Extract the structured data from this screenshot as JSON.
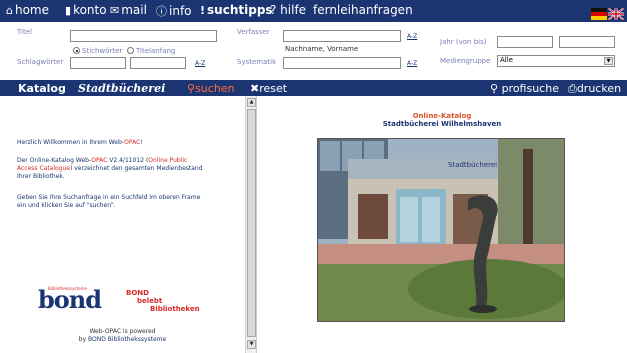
{
  "nav": {
    "home": "home",
    "konto": "konto",
    "mail": "mail",
    "info": "info",
    "suchtipps": "suchtipps",
    "hilfe": "? hilfe",
    "fernleih": "fernleihanfragen"
  },
  "form": {
    "titel_label": "Titel",
    "verfasser_label": "Verfasser",
    "jahr_label": "Jahr (von bis)",
    "schlag_label": "Schlagwörter",
    "systematik_label": "Systematik",
    "mediengruppe_label": "Mediengruppe",
    "radio_stich": "Stichwörter",
    "radio_titel": "Titelanfang",
    "name_hint": "Nachname, Vorname",
    "az": "A-Z",
    "mediengruppe_value": "Alle"
  },
  "actions": {
    "katalog": "Katalog",
    "stadt": "Stadtbücherei",
    "suchen": "suchen",
    "reset": "reset",
    "profisuche": "profisuche",
    "drucken": "drucken"
  },
  "left": {
    "welcome_pre": "Herzlich Willkommen in Ihrem Web-",
    "welcome_opac": "OPAC",
    "welcome_post": "!",
    "p1_a": "Der Online-Katalog Web-",
    "p1_opac": "OPAC",
    "p1_b": " V2.4/11012 (",
    "p1_olpac": "Online Public",
    "p1_line2_red": "Access Catalogue",
    "p1_line2_rest": ") verzeichnet den gesamten Medienbestand",
    "p1_line3": "Ihrer Bibliothek.",
    "p2_line1": "Geben Sie Ihre Suchanfrage in ein Suchfeld im oberen Frame",
    "p2_line2": "ein und klicken Sie auf \"suchen\".",
    "bond_small": "Bibliothekssysteme",
    "bond_big": "bond",
    "slogan1": "BOND",
    "slogan2": "belebt",
    "slogan3": "Bibliotheken",
    "powered1": "Web-OPAC is powered",
    "powered_by": "by ",
    "powered_link": "BOND Bibliothekssysteme"
  },
  "right": {
    "title1": "Online-Katalog",
    "title2": "Stadtbücherei Wilhelmshaven",
    "sign_text": "Stadtbücherei"
  },
  "colors": {
    "navy": "#1b3572",
    "accent_red": "#d62b2b",
    "accent_orange": "#ff6a3c"
  }
}
